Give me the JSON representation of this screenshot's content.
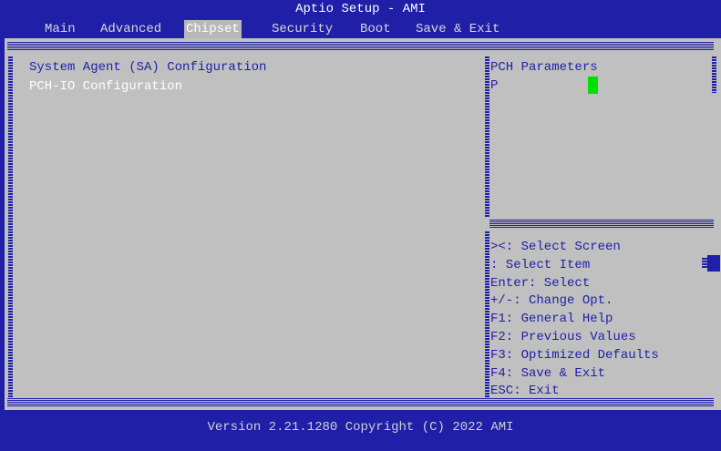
{
  "window": {
    "title": "Aptio Setup - AMI"
  },
  "menu": {
    "items": [
      "Main",
      "Advanced",
      "Chipset",
      "Security",
      "Boot",
      "Save & Exit"
    ],
    "active": "Chipset"
  },
  "left_panel": {
    "items": [
      {
        "label": "System Agent (SA) Configuration",
        "selected": false
      },
      {
        "label": "PCH-IO Configuration",
        "selected": true
      }
    ]
  },
  "help_panel": {
    "title": "PCH Parameters",
    "body": "P"
  },
  "keys": [
    "><: Select Screen",
    ": Select Item",
    "Enter: Select",
    "+/-: Change Opt.",
    "F1: General Help",
    "F2: Previous Values",
    "F3: Optimized Defaults",
    "F4: Save & Exit",
    "ESC: Exit"
  ],
  "footer": {
    "text": "Version 2.21.1280 Copyright (C) 2022 AMI"
  },
  "colors": {
    "background_blue": "#1f1fa8",
    "panel_grey": "#c0c0c0",
    "selected_text": "#ffffff",
    "cursor_green": "#00e000"
  }
}
